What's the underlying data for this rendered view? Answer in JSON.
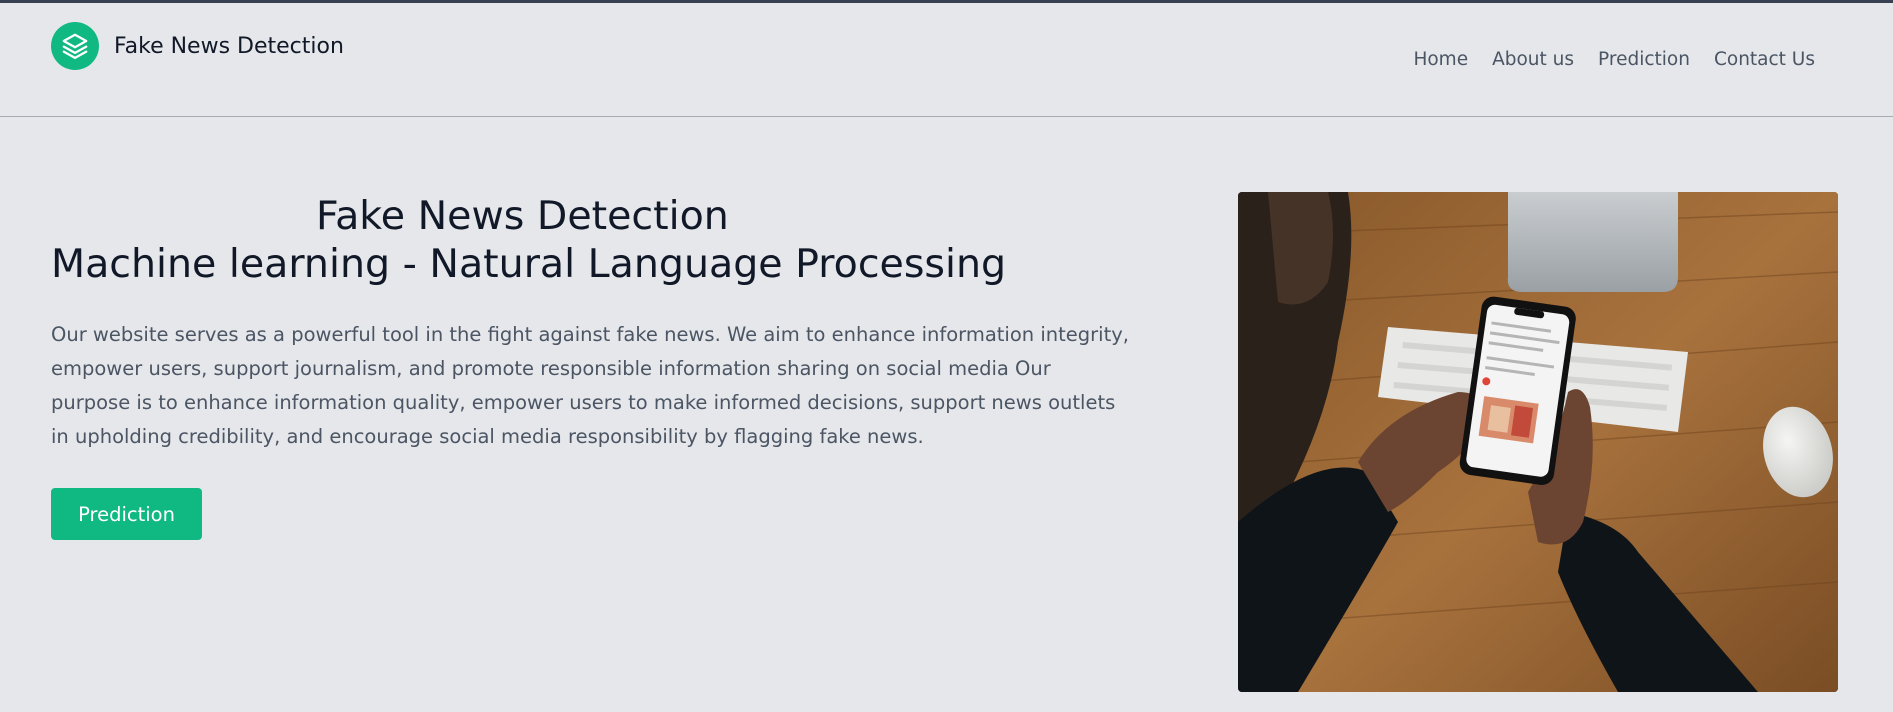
{
  "brand": {
    "name": "Fake News Detection",
    "logo_icon": "layers-icon",
    "accent_color": "#10b981"
  },
  "nav": {
    "items": [
      {
        "label": "Home"
      },
      {
        "label": "About us"
      },
      {
        "label": "Prediction"
      },
      {
        "label": "Contact Us"
      }
    ]
  },
  "hero": {
    "title_line1": "Fake News Detection",
    "title_line2": "Machine learning - Natural Language Processing",
    "description": "Our website serves as a powerful tool in the fight against fake news. We aim to enhance information integrity, empower users, support journalism, and promote responsible information sharing on social media Our purpose is to enhance information quality, empower users to make informed decisions, support news outlets in upholding credibility, and encourage social media responsibility by flagging fake news.",
    "button_label": "Prediction",
    "image_alt": "person holding smartphone over desk with keyboard"
  }
}
